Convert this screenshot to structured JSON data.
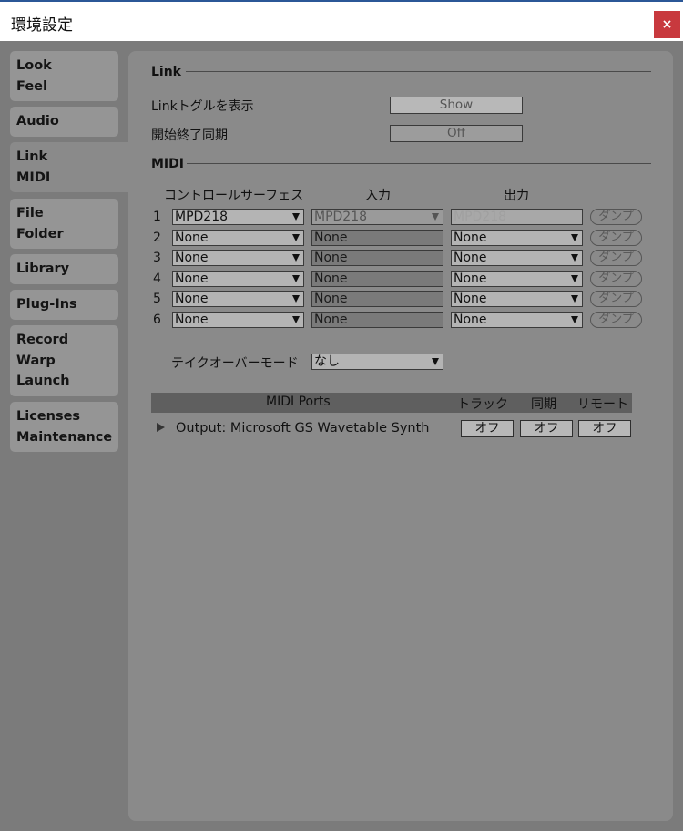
{
  "window": {
    "title": "環境設定",
    "close_glyph": "×"
  },
  "sidebar": {
    "items": [
      {
        "lines": [
          "Look",
          "Feel"
        ]
      },
      {
        "lines": [
          "Audio"
        ]
      },
      {
        "lines": [
          "Link",
          "MIDI"
        ]
      },
      {
        "lines": [
          "File",
          "Folder"
        ]
      },
      {
        "lines": [
          "Library"
        ]
      },
      {
        "lines": [
          "Plug-Ins"
        ]
      },
      {
        "lines": [
          "Record",
          "Warp",
          "Launch"
        ]
      },
      {
        "lines": [
          "Licenses",
          "Maintenance"
        ]
      }
    ],
    "active_index": 2
  },
  "link": {
    "section_title": "Link",
    "show_toggle_label": "Linkトグルを表示",
    "show_toggle_value": "Show",
    "start_stop_label": "開始終了同期",
    "start_stop_value": "Off"
  },
  "midi": {
    "section_title": "MIDI",
    "headers": {
      "surface": "コントロールサーフェス",
      "input": "入力",
      "output": "出力"
    },
    "rows": [
      {
        "num": "1",
        "surface": "MPD218",
        "input": "MPD218",
        "output": "MPD218",
        "dump": "ダンプ"
      },
      {
        "num": "2",
        "surface": "None",
        "input": "None",
        "output": "None",
        "dump": "ダンプ"
      },
      {
        "num": "3",
        "surface": "None",
        "input": "None",
        "output": "None",
        "dump": "ダンプ"
      },
      {
        "num": "4",
        "surface": "None",
        "input": "None",
        "output": "None",
        "dump": "ダンプ"
      },
      {
        "num": "5",
        "surface": "None",
        "input": "None",
        "output": "None",
        "dump": "ダンプ"
      },
      {
        "num": "6",
        "surface": "None",
        "input": "None",
        "output": "None",
        "dump": "ダンプ"
      }
    ],
    "takeover_label": "テイクオーバーモード",
    "takeover_value": "なし"
  },
  "ports": {
    "header": "MIDI Ports",
    "col_track": "トラック",
    "col_sync": "同期",
    "col_remote": "リモート",
    "row": {
      "label": "Output:  Microsoft GS Wavetable Synth",
      "track": "オフ",
      "sync": "オフ",
      "remote": "オフ"
    }
  }
}
